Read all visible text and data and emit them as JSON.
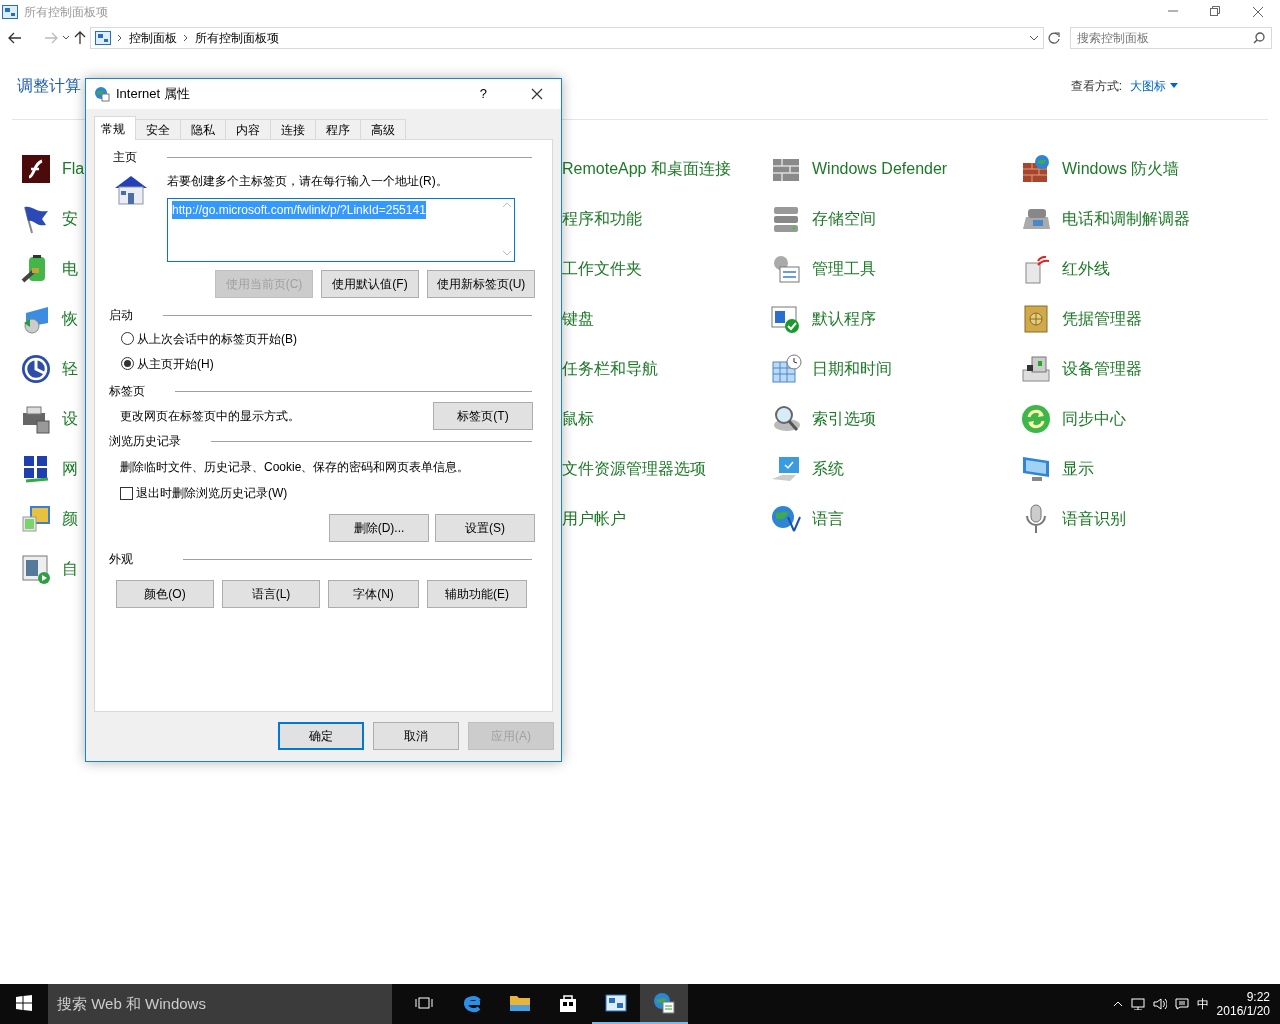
{
  "window": {
    "title": "所有控制面板项"
  },
  "address": {
    "breadcrumb": [
      "控制面板",
      "所有控制面板项"
    ],
    "search": {
      "placeholder": "搜索控制面板"
    }
  },
  "header": {
    "title": "调整计算",
    "view_label": "查看方式:",
    "view_value": "大图标"
  },
  "items": {
    "column_1": [
      {
        "label": "Fla"
      },
      {
        "label": "安"
      },
      {
        "label": "电"
      },
      {
        "label": "恢"
      },
      {
        "label": "轻"
      },
      {
        "label": "设"
      },
      {
        "label": "网"
      },
      {
        "label": "颜"
      },
      {
        "label": "自"
      }
    ],
    "column_3": [
      {
        "label": "RemoteApp 和桌面连接"
      },
      {
        "label": "程序和功能"
      },
      {
        "label": "工作文件夹"
      },
      {
        "label": "键盘"
      },
      {
        "label": "任务栏和导航"
      },
      {
        "label": "鼠标"
      },
      {
        "label": "文件资源管理器选项"
      },
      {
        "label": "用户帐户"
      }
    ],
    "column_4": [
      {
        "label": "Windows Defender"
      },
      {
        "label": "存储空间"
      },
      {
        "label": "管理工具"
      },
      {
        "label": "默认程序"
      },
      {
        "label": "日期和时间"
      },
      {
        "label": "索引选项"
      },
      {
        "label": "系统"
      },
      {
        "label": "语言"
      }
    ],
    "column_5": [
      {
        "label": "Windows 防火墙"
      },
      {
        "label": "电话和调制解调器"
      },
      {
        "label": "红外线"
      },
      {
        "label": "凭据管理器"
      },
      {
        "label": "设备管理器"
      },
      {
        "label": "同步中心"
      },
      {
        "label": "显示"
      },
      {
        "label": "语音识别"
      }
    ]
  },
  "dialog": {
    "title": "Internet 属性",
    "help": "?",
    "tabs": [
      {
        "label": "常规",
        "selected": true
      },
      {
        "label": "安全",
        "selected": false
      },
      {
        "label": "隐私",
        "selected": false
      },
      {
        "label": "内容",
        "selected": false
      },
      {
        "label": "连接",
        "selected": false
      },
      {
        "label": "程序",
        "selected": false
      },
      {
        "label": "高级",
        "selected": false
      }
    ],
    "home": {
      "heading": "主页",
      "instruction": "若要创建多个主标签页，请在每行输入一个地址(R)。",
      "value": "http://go.microsoft.com/fwlink/p/?LinkId=255141",
      "buttons": [
        {
          "label": "使用当前页(C)",
          "disabled": true
        },
        {
          "label": "使用默认值(F)",
          "disabled": false
        },
        {
          "label": "使用新标签页(U)",
          "disabled": false
        }
      ]
    },
    "startup": {
      "heading": "启动",
      "options": [
        {
          "label": "从上次会话中的标签页开始(B)",
          "selected": false
        },
        {
          "label": "从主页开始(H)",
          "selected": true
        }
      ]
    },
    "tabs_section": {
      "heading": "标签页",
      "description": "更改网页在标签页中的显示方式。",
      "button": "标签页(T)"
    },
    "history": {
      "heading": "浏览历史记录",
      "description": "删除临时文件、历史记录、Cookie、保存的密码和网页表单信息。",
      "checkbox": {
        "label": "退出时删除浏览历史记录(W)",
        "checked": false
      },
      "buttons": [
        "删除(D)...",
        "设置(S)"
      ]
    },
    "appearance": {
      "heading": "外观",
      "buttons": [
        "颜色(O)",
        "语言(L)",
        "字体(N)",
        "辅助功能(E)"
      ]
    },
    "footer": [
      {
        "label": "确定",
        "default": true,
        "disabled": false
      },
      {
        "label": "取消",
        "default": false,
        "disabled": false
      },
      {
        "label": "应用(A)",
        "default": false,
        "disabled": true
      }
    ]
  },
  "taskbar": {
    "search_placeholder": "搜索 Web 和 Windows",
    "apps": [
      {
        "open": false,
        "active": false
      },
      {
        "open": false,
        "active": false
      },
      {
        "open": false,
        "active": false
      },
      {
        "open": false,
        "active": false
      },
      {
        "open": true,
        "active": false
      },
      {
        "open": true,
        "active": true
      }
    ],
    "ime": "中",
    "time": "9:22",
    "date": "2016/1/20"
  }
}
